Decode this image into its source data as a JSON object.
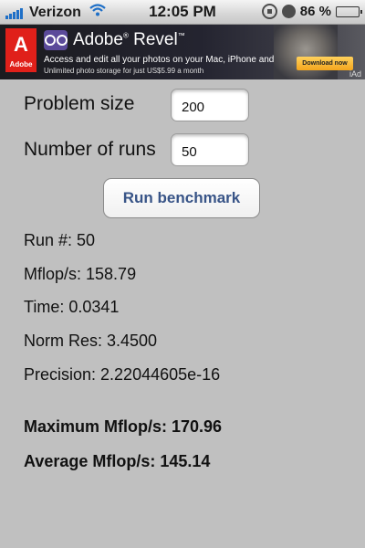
{
  "status_bar": {
    "carrier": "Verizon",
    "time": "12:05 PM",
    "battery_percent": "86 %",
    "battery_level": 0.86
  },
  "ad": {
    "brand": "Adobe",
    "title": "Adobe",
    "title_product": "Revel",
    "line1": "Access and edit all your photos on your Mac, iPhone and iPad",
    "line2": "Unlimited photo storage for just US$5.99 a month",
    "cta": "Download now",
    "network": "iAd"
  },
  "form": {
    "problem_size_label": "Problem size",
    "problem_size_value": "200",
    "num_runs_label": "Number of runs",
    "num_runs_value": "50",
    "run_button": "Run benchmark"
  },
  "results": {
    "run": "Run #: 50",
    "mflops": "Mflop/s: 158.79",
    "time": "Time: 0.0341",
    "norm_res": "Norm Res: 3.4500",
    "precision": "Precision: 2.22044605e-16",
    "max_mflops": "Maximum Mflop/s: 170.96",
    "avg_mflops": "Average Mflop/s: 145.14"
  }
}
